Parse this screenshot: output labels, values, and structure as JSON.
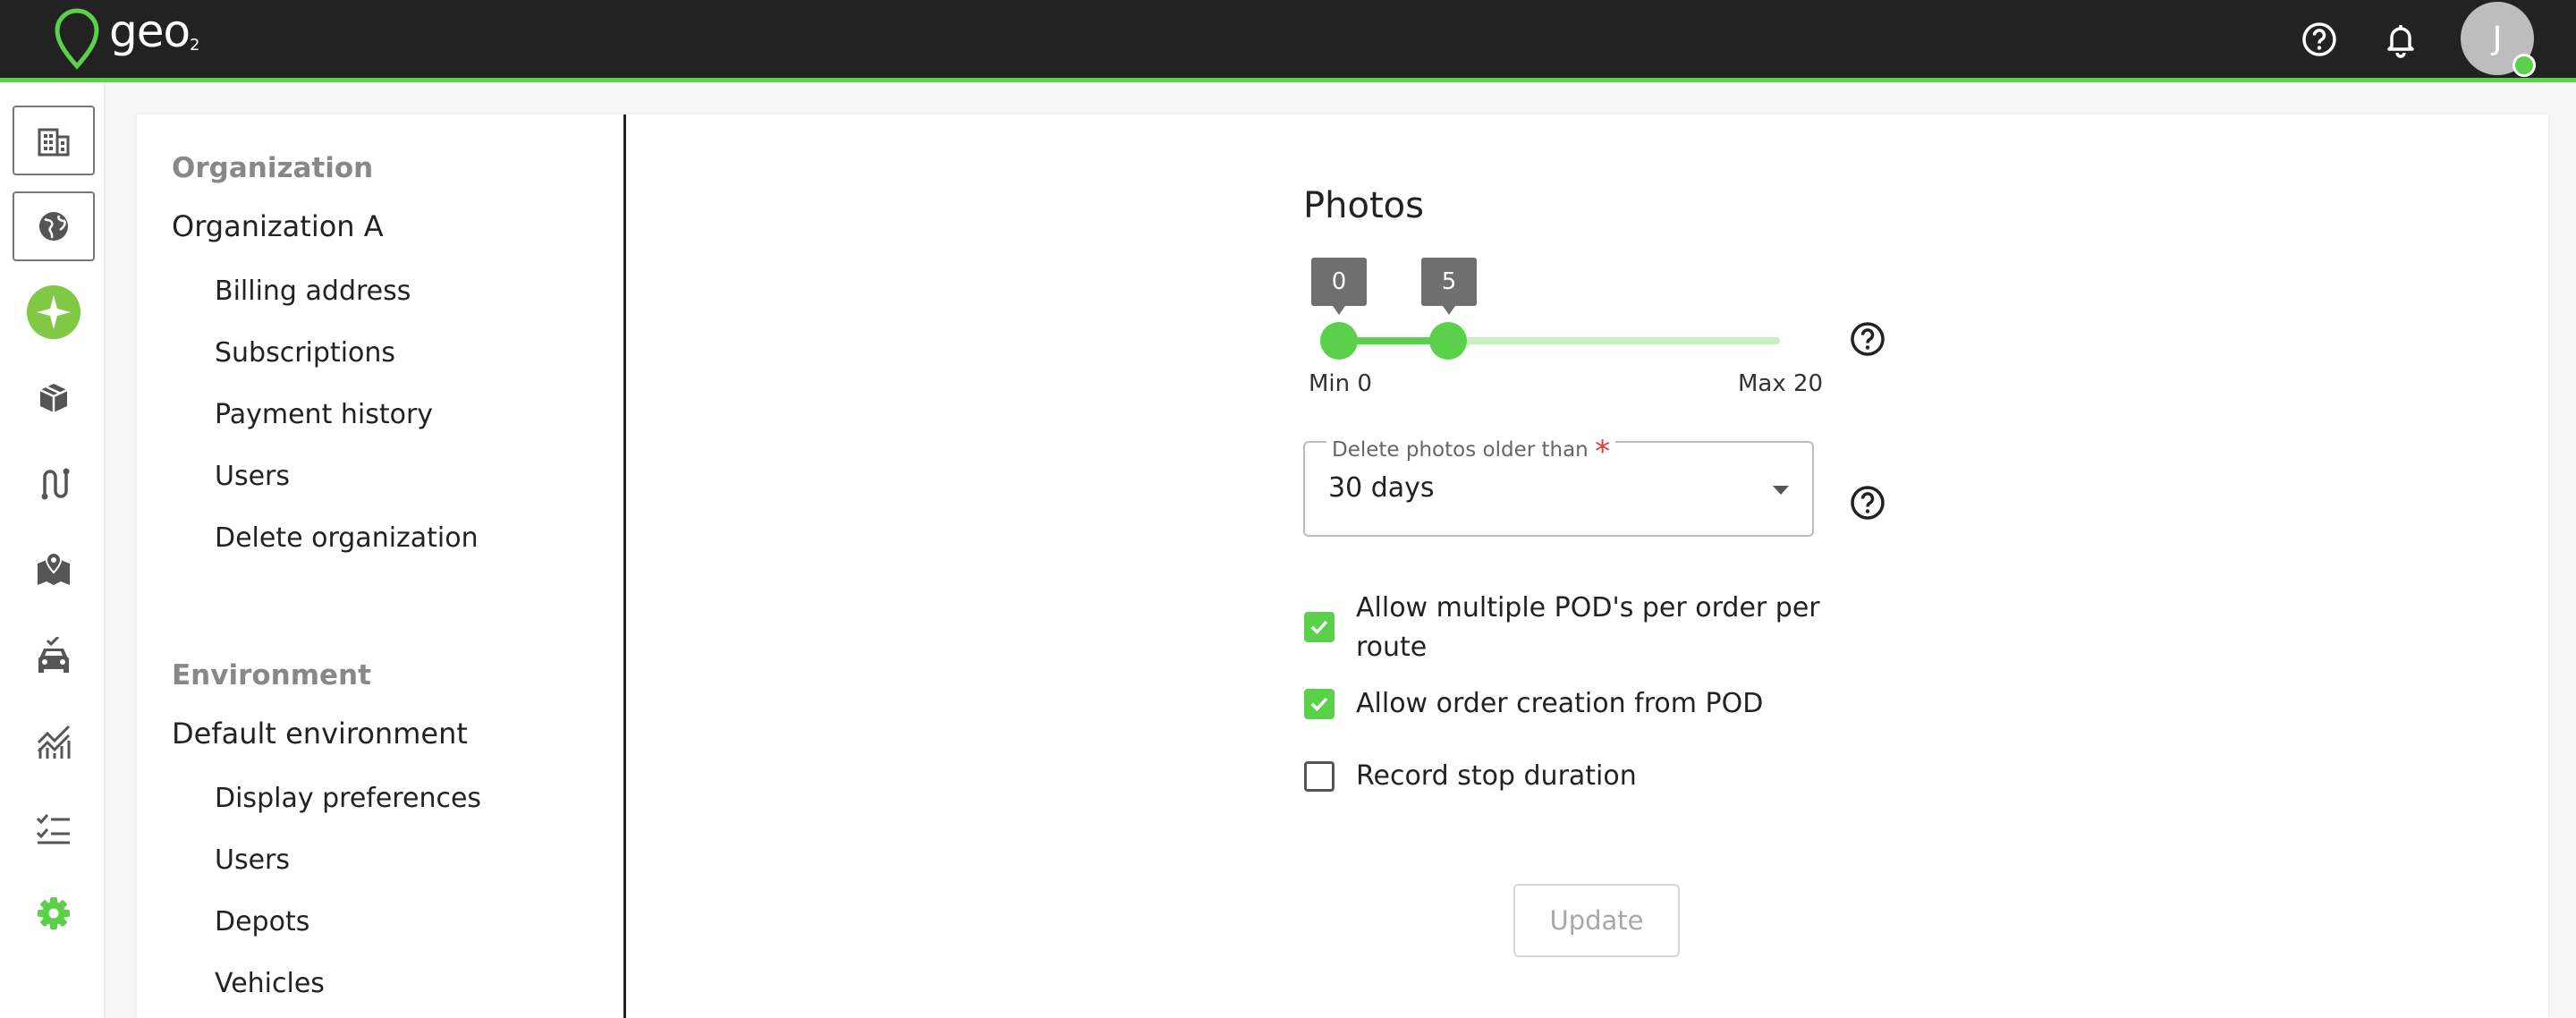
{
  "app": {
    "logo_text": "geo",
    "logo_sub": "2",
    "avatar_initial": "J"
  },
  "colors": {
    "brand_green": "#5bd04b",
    "topbar": "#222222"
  },
  "topbar_icons": [
    "help-circle-icon",
    "bell-icon",
    "avatar"
  ],
  "rail_icons": [
    "building-icon",
    "globe-icon",
    "sparkle-icon",
    "package-icon",
    "route-icon",
    "map-pin-icon",
    "vehicle-icon",
    "analytics-icon",
    "checklist-icon",
    "gear-icon"
  ],
  "nav": {
    "org_heading": "Organization",
    "org_name": "Organization A",
    "org_items": [
      "Billing address",
      "Subscriptions",
      "Payment history",
      "Users",
      "Delete organization"
    ],
    "env_heading": "Environment",
    "env_name": "Default environment",
    "env_items": [
      "Display preferences",
      "Users",
      "Depots",
      "Vehicles"
    ]
  },
  "photos": {
    "title": "Photos",
    "slider": {
      "min": 0,
      "max": 20,
      "low": 0,
      "high": 5,
      "low_label": "0",
      "high_label": "5",
      "min_label": "Min 0",
      "max_label": "Max 20"
    },
    "delete_label": "Delete photos older than",
    "delete_required": "*",
    "delete_value": "30 days"
  },
  "options": {
    "multiple_pod": {
      "label": "Allow multiple POD's per order per route",
      "checked": true
    },
    "order_from_pod": {
      "label": "Allow order creation from POD",
      "checked": true
    },
    "record_stop": {
      "label": "Record stop duration",
      "checked": false
    }
  },
  "update_label": "Update"
}
